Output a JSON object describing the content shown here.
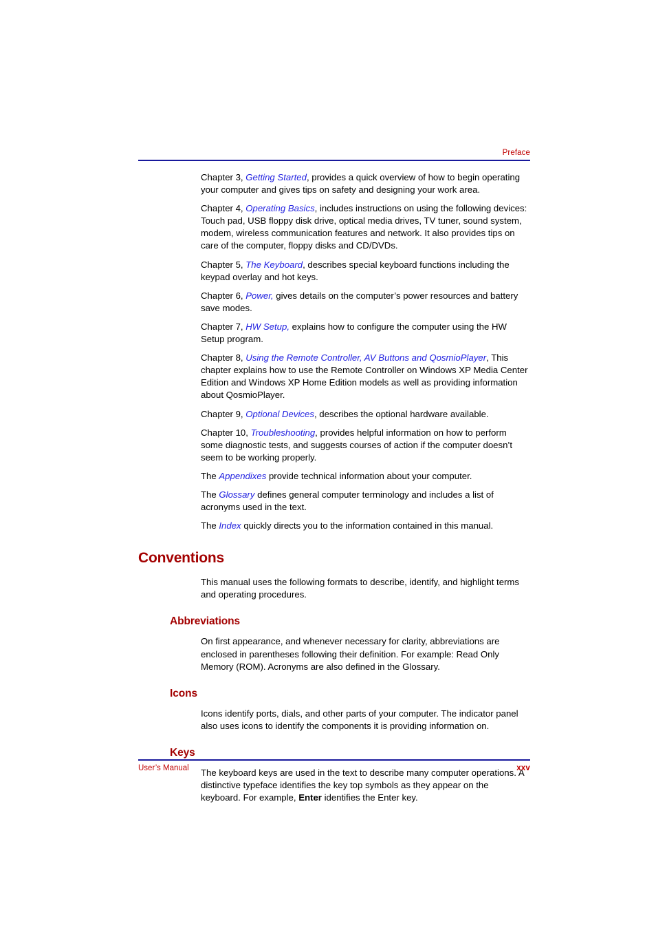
{
  "page": {
    "header_title": "Preface",
    "rule_color": "#17189c",
    "heading_color": "#a30000",
    "header_text_color": "#c00000",
    "xref_color": "#2121e0"
  },
  "paragraphs": [
    {
      "id": "chapter-3",
      "lead": "Chapter 3, ",
      "xref": "Getting Started",
      "tail": ", provides a quick overview of how to begin operating your computer and gives tips on safety and designing your work area."
    },
    {
      "id": "chapter-4",
      "lead": "Chapter 4, ",
      "xref": "Operating Basics",
      "tail": ", includes instructions on using the following devices: Touch pad, USB floppy disk drive, optical media drives, TV tuner, sound system, modem, wireless communication features and network. It also provides tips on care of the computer, floppy disks and CD/DVDs."
    },
    {
      "id": "chapter-5",
      "lead": "Chapter 5, ",
      "xref": "The Keyboard",
      "tail": ", describes special keyboard functions including the keypad overlay and hot keys."
    },
    {
      "id": "chapter-6",
      "lead": "Chapter 6, ",
      "xref": "Power,",
      "tail": " gives details on the computer’s power resources and battery save modes."
    },
    {
      "id": "chapter-7",
      "lead": "Chapter 7, ",
      "xref": "HW Setup,",
      "tail": " explains how to configure the computer using the HW Setup program."
    },
    {
      "id": "chapter-8",
      "lead": "Chapter 8, ",
      "xref": "Using the Remote Controller, AV Buttons and QosmioPlayer",
      "tail": ", This chapter explains how to use the Remote Controller on Windows XP Media Center Edition and Windows XP Home Edition models as well as providing information about QosmioPlayer."
    },
    {
      "id": "chapter-9",
      "lead": "Chapter 9, ",
      "xref": "Optional Devices",
      "tail": ", describes the optional hardware available."
    },
    {
      "id": "chapter-10",
      "lead": "Chapter 10, ",
      "xref": "Troubleshooting",
      "tail": ", provides helpful information on how to perform some diagnostic tests, and suggests courses of action if the computer doesn’t seem to be working properly."
    },
    {
      "id": "appendixes",
      "lead": "The ",
      "xref": "Appendixes",
      "tail": " provide technical information about your computer."
    },
    {
      "id": "glossary",
      "lead": "The ",
      "xref": "Glossary",
      "tail": " defines general computer terminology and includes a list of acronyms used in the text."
    },
    {
      "id": "index",
      "lead": "The ",
      "xref": "Index",
      "tail": " quickly directs you to the information contained in this manual."
    }
  ],
  "conventions": {
    "heading": "Conventions",
    "intro": "This manual uses the following formats to describe, identify, and highlight terms and operating procedures.",
    "abbreviations": {
      "heading": "Abbreviations",
      "body": "On first appearance, and whenever necessary for clarity, abbreviations are enclosed in parentheses following their definition. For example: Read Only Memory (ROM). Acronyms are also defined in the Glossary."
    },
    "icons": {
      "heading": "Icons",
      "body": "Icons identify ports, dials, and other parts of your computer. The indicator panel also uses icons to identify the components it is providing information on."
    },
    "keys": {
      "heading": "Keys",
      "body_lead": "The keyboard keys are used in the text to describe many computer operations. A distinctive typeface identifies the key top symbols as they appear on the keyboard. For example, ",
      "body_kbd": "Enter",
      "body_tail": " identifies the Enter key."
    }
  },
  "footer": {
    "left": "User’s Manual",
    "page_number": "xxv"
  }
}
